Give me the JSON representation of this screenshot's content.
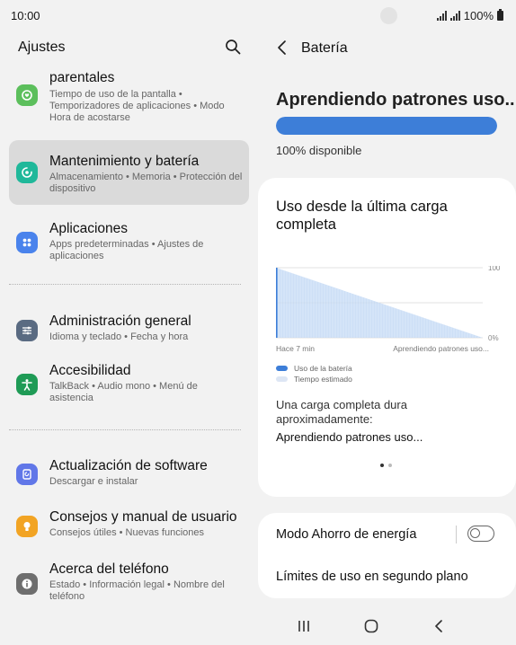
{
  "status": {
    "time": "10:00",
    "battery": "100%"
  },
  "left": {
    "title": "Ajustes",
    "items": [
      {
        "title": "parentales",
        "subtitle": "Tiempo de uso de la pantalla • Temporizadores de aplicaciones • Modo Hora de acostarse",
        "icon": "parental-controls-icon",
        "color": "#5cbf5c"
      },
      {
        "title": "Mantenimiento y batería",
        "subtitle": "Almacenamiento • Memoria • Protección del dispositivo",
        "icon": "device-care-icon",
        "color": "#20b89a"
      },
      {
        "title": "Aplicaciones",
        "subtitle": "Apps predeterminadas • Ajustes de aplicaciones",
        "icon": "apps-icon",
        "color": "#4a83ec"
      },
      {
        "title": "Administración general",
        "subtitle": "Idioma y teclado • Fecha y hora",
        "icon": "sliders-icon",
        "color": "#5a6b82"
      },
      {
        "title": "Accesibilidad",
        "subtitle": "TalkBack • Audio mono • Menú de asistencia",
        "icon": "accessibility-icon",
        "color": "#1f9b56"
      },
      {
        "title": "Actualización de software",
        "subtitle": "Descargar e instalar",
        "icon": "software-update-icon",
        "color": "#6177e8"
      },
      {
        "title": "Consejos y manual de usuario",
        "subtitle": "Consejos útiles • Nuevas funciones",
        "icon": "tips-icon",
        "color": "#f2a424"
      },
      {
        "title": "Acerca del teléfono",
        "subtitle": "Estado • Información legal • Nombre del teléfono",
        "icon": "info-icon",
        "color": "#6e6e6e"
      }
    ]
  },
  "right": {
    "title": "Batería",
    "learning": "Aprendiendo patrones uso...",
    "battery_level": 1.0,
    "available": "100% disponible",
    "usage": {
      "title": "Uso desde la última carga completa",
      "x_left": "Hace 7 min",
      "x_right": "Aprendiendo patrones uso...",
      "legend": [
        "Uso de la batería",
        "Tiempo estimado"
      ],
      "charge_label": "Una carga completa dura aproximadamente:",
      "charge_value": "Aprendiendo patrones uso..."
    },
    "options": {
      "power_saving": "Modo Ahorro de energía",
      "background_limits": "Límites de uso en segundo plano"
    }
  },
  "chart_data": {
    "type": "area",
    "x": [
      "Hace 7 min",
      "Aprendiendo patrones uso..."
    ],
    "series": [
      {
        "name": "Uso de la batería",
        "values": [
          100,
          100
        ]
      },
      {
        "name": "Tiempo estimado",
        "values": [
          100,
          0
        ]
      }
    ],
    "y_ticks": [
      "100",
      "0%"
    ],
    "ylim": [
      0,
      100
    ],
    "grid": true,
    "colors": {
      "usage": "#3d7ed8",
      "estimated": "#bcd4f3"
    }
  }
}
